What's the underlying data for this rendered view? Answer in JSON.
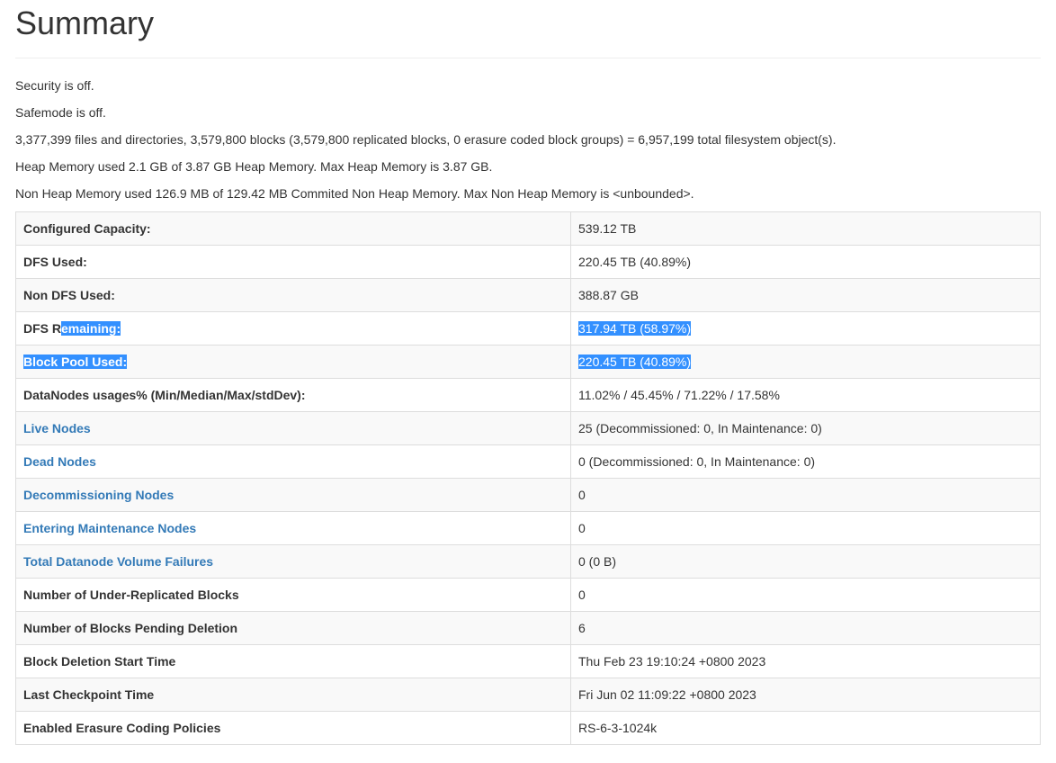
{
  "title": "Summary",
  "info": [
    "Security is off.",
    "Safemode is off.",
    "3,377,399 files and directories, 3,579,800 blocks (3,579,800 replicated blocks, 0 erasure coded block groups) = 6,957,199 total filesystem object(s).",
    "Heap Memory used 2.1 GB of 3.87 GB Heap Memory. Max Heap Memory is 3.87 GB.",
    "Non Heap Memory used 126.9 MB of 129.42 MB Commited Non Heap Memory. Max Non Heap Memory is <unbounded>."
  ],
  "rows": {
    "configured_capacity": {
      "label": "Configured Capacity:",
      "value": "539.12 TB"
    },
    "dfs_used": {
      "label": "DFS Used:",
      "value": "220.45 TB (40.89%)"
    },
    "non_dfs_used": {
      "label": "Non DFS Used:",
      "value": "388.87 GB"
    },
    "dfs_remaining": {
      "label_prefix": "DFS R",
      "label_selected": "emaining:",
      "value": "317.94 TB (58.97%)"
    },
    "block_pool_used": {
      "label": "Block Pool Used:",
      "value": "220.45 TB (40.89%)"
    },
    "datanodes_usages": {
      "label": "DataNodes usages% (Min/Median/Max/stdDev):",
      "value": "11.02% / 45.45% / 71.22% / 17.58%"
    },
    "live_nodes": {
      "label": "Live Nodes",
      "value": "25 (Decommissioned: 0, In Maintenance: 0)"
    },
    "dead_nodes": {
      "label": "Dead Nodes",
      "value": "0 (Decommissioned: 0, In Maintenance: 0)"
    },
    "decommissioning_nodes": {
      "label": "Decommissioning Nodes",
      "value": "0"
    },
    "entering_maintenance_nodes": {
      "label": "Entering Maintenance Nodes",
      "value": "0"
    },
    "total_volume_failures": {
      "label": "Total Datanode Volume Failures",
      "value": "0 (0 B)"
    },
    "under_replicated_blocks": {
      "label": "Number of Under-Replicated Blocks",
      "value": "0"
    },
    "blocks_pending_deletion": {
      "label": "Number of Blocks Pending Deletion",
      "value": "6"
    },
    "block_deletion_start_time": {
      "label": "Block Deletion Start Time",
      "value": "Thu Feb 23 19:10:24 +0800 2023"
    },
    "last_checkpoint_time": {
      "label": "Last Checkpoint Time",
      "value": "Fri Jun 02 11:09:22 +0800 2023"
    },
    "enabled_ec_policies": {
      "label": "Enabled Erasure Coding Policies",
      "value": "RS-6-3-1024k"
    }
  },
  "colors": {
    "link": "#337ab7",
    "selection": "#3390ff",
    "text": "#333333",
    "border": "#dddddd",
    "row_stripe": "#f9f9f9"
  }
}
